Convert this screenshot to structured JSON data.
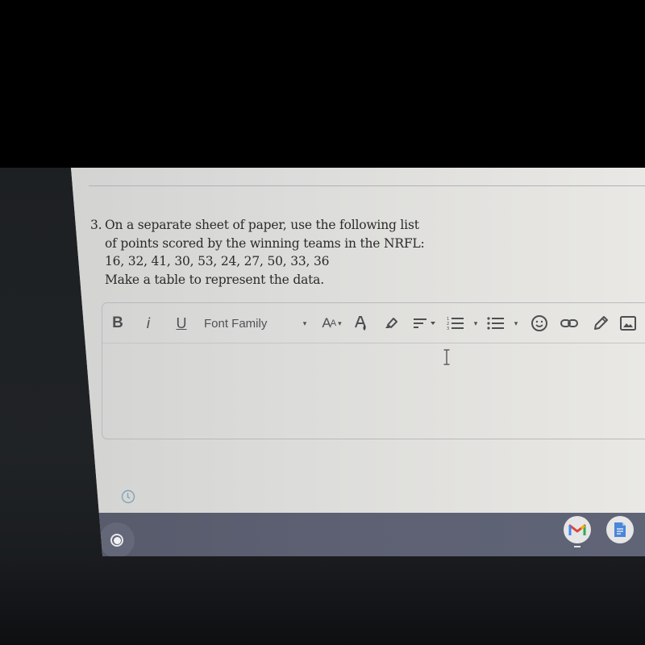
{
  "question": {
    "number": "3.",
    "lines": [
      "On a separate sheet of paper, use the following list",
      "of points scored by the winning teams in the NRFL:",
      "16, 32, 41, 30, 53, 24, 27, 50, 33, 36",
      "Make a table to represent the data."
    ],
    "data_values": [
      16,
      32,
      41,
      30,
      53,
      24,
      27,
      50,
      33,
      36
    ]
  },
  "editor": {
    "toolbar": {
      "bold_label": "B",
      "italic_label": "i",
      "underline_label": "U",
      "font_family_label": "Font Family",
      "font_size_label": "A",
      "font_size_small_label": "A",
      "caret": "▾"
    },
    "body_value": ""
  },
  "shelf": {
    "apps": [
      {
        "name": "Gmail",
        "icon": "gmail-icon"
      },
      {
        "name": "Google Docs",
        "icon": "docs-icon"
      }
    ]
  },
  "colors": {
    "page_bg": "#dcdcda",
    "text": "#2b2b2b",
    "toolbar_icon": "#4d4f52",
    "shelf_bg": "#5d6173",
    "history_icon": "#7fa4b8"
  }
}
